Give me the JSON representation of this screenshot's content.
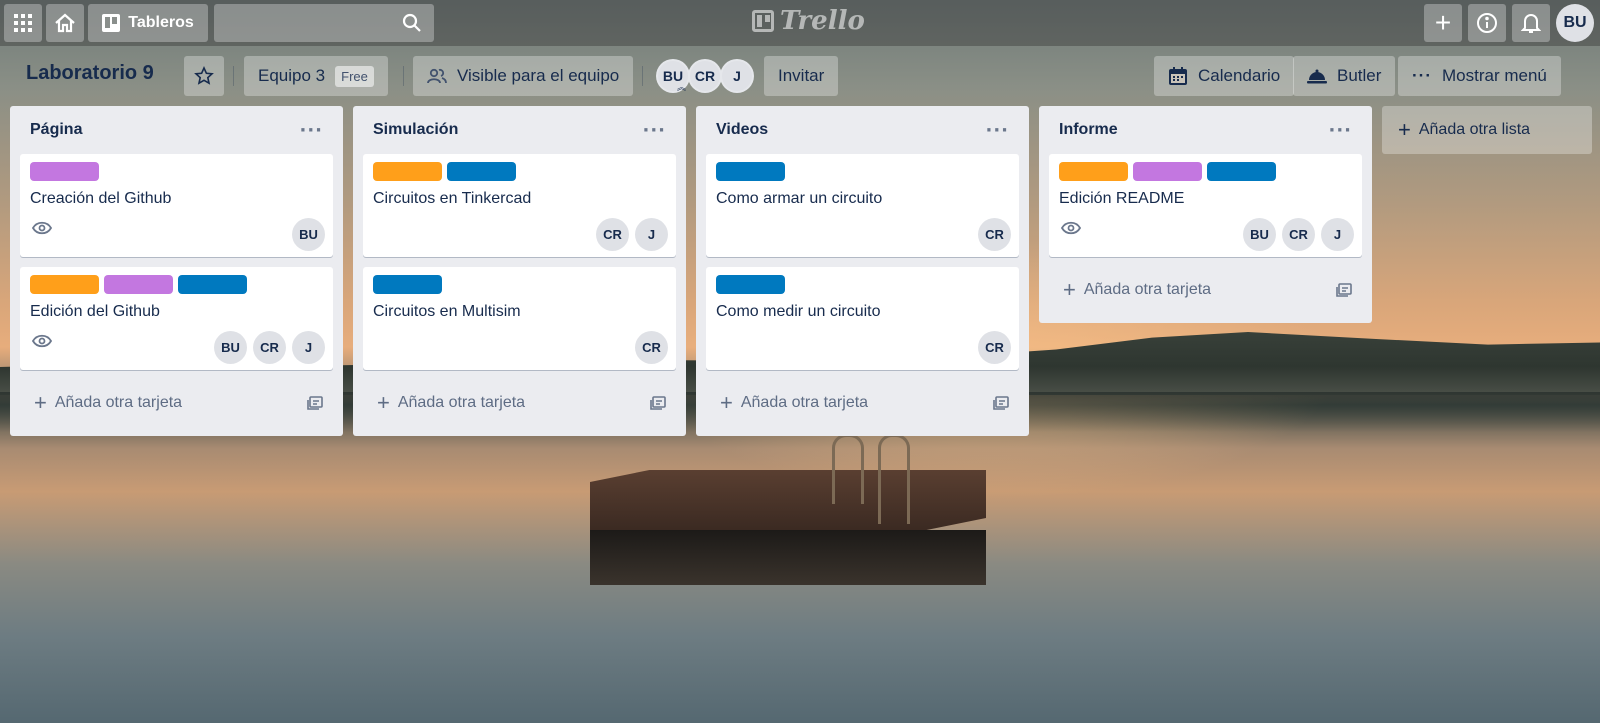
{
  "header": {
    "boards_label": "Tableros",
    "logo_text": "Trello",
    "user_initials": "BU",
    "icons": [
      "apps-grid-icon",
      "home-icon",
      "boards-icon",
      "search-icon",
      "plus-icon",
      "info-icon",
      "bell-icon"
    ]
  },
  "board": {
    "title": "Laboratorio 9",
    "team_label": "Equipo 3",
    "team_plan": "Free",
    "visibility_label": "Visible para el equipo",
    "members": [
      "BU",
      "CR",
      "J"
    ],
    "invite_label": "Invitar",
    "calendar_label": "Calendario",
    "butler_label": "Butler",
    "menu_label": "Mostrar menú"
  },
  "labels": {
    "orange": "#ff9f1a",
    "purple": "#c377e0",
    "blue": "#0079bf"
  },
  "lists": [
    {
      "title": "Página",
      "cards": [
        {
          "title": "Creación del Github",
          "labels": [
            "purple"
          ],
          "watch": true,
          "members": [
            "BU"
          ]
        },
        {
          "title": "Edición del Github",
          "labels": [
            "orange",
            "purple",
            "blue"
          ],
          "watch": true,
          "members": [
            "BU",
            "CR",
            "J"
          ]
        }
      ],
      "add_card": "Añada otra tarjeta"
    },
    {
      "title": "Simulación",
      "cards": [
        {
          "title": "Circuitos en Tinkercad",
          "labels": [
            "orange",
            "blue"
          ],
          "watch": false,
          "members": [
            "CR",
            "J"
          ]
        },
        {
          "title": "Circuitos en Multisim",
          "labels": [
            "blue"
          ],
          "watch": false,
          "members": [
            "CR"
          ]
        }
      ],
      "add_card": "Añada otra tarjeta"
    },
    {
      "title": "Videos",
      "cards": [
        {
          "title": "Como armar un circuito",
          "labels": [
            "blue"
          ],
          "watch": false,
          "members": [
            "CR"
          ]
        },
        {
          "title": "Como medir un circuito",
          "labels": [
            "blue"
          ],
          "watch": false,
          "members": [
            "CR"
          ]
        }
      ],
      "add_card": "Añada otra tarjeta"
    },
    {
      "title": "Informe",
      "cards": [
        {
          "title": "Edición README",
          "labels": [
            "orange",
            "purple",
            "blue"
          ],
          "watch": true,
          "members": [
            "BU",
            "CR",
            "J"
          ]
        }
      ],
      "add_card": "Añada otra tarjeta"
    }
  ],
  "add_list_label": "Añada otra lista"
}
